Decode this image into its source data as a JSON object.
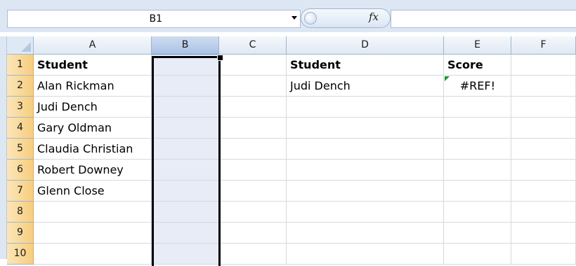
{
  "formula_bar": {
    "name_box": "B1",
    "fx_label": "fx",
    "formula": ""
  },
  "columns": [
    "A",
    "B",
    "C",
    "D",
    "E",
    "F"
  ],
  "selected_column": "B",
  "rows": [
    {
      "num": "1",
      "A": "Student",
      "D": "Student",
      "E": "Score"
    },
    {
      "num": "2",
      "A": "Alan Rickman",
      "D": "Judi Dench",
      "E": "#REF!"
    },
    {
      "num": "3",
      "A": "Judi Dench",
      "D": "",
      "E": ""
    },
    {
      "num": "4",
      "A": "Gary Oldman",
      "D": "",
      "E": ""
    },
    {
      "num": "5",
      "A": "Claudia Christian",
      "D": "",
      "E": ""
    },
    {
      "num": "6",
      "A": "Robert Downey",
      "D": "",
      "E": ""
    },
    {
      "num": "7",
      "A": "Glenn Close",
      "D": "",
      "E": ""
    },
    {
      "num": "8",
      "A": "",
      "D": "",
      "E": ""
    },
    {
      "num": "9",
      "A": "",
      "D": "",
      "E": ""
    },
    {
      "num": "10",
      "A": "",
      "D": "",
      "E": ""
    }
  ],
  "colors": {
    "selection_border": "#000000",
    "selected_header": "#a9c3e6",
    "row_header_highlight": "#f7cd7e",
    "error_indicator": "#129a2b"
  }
}
